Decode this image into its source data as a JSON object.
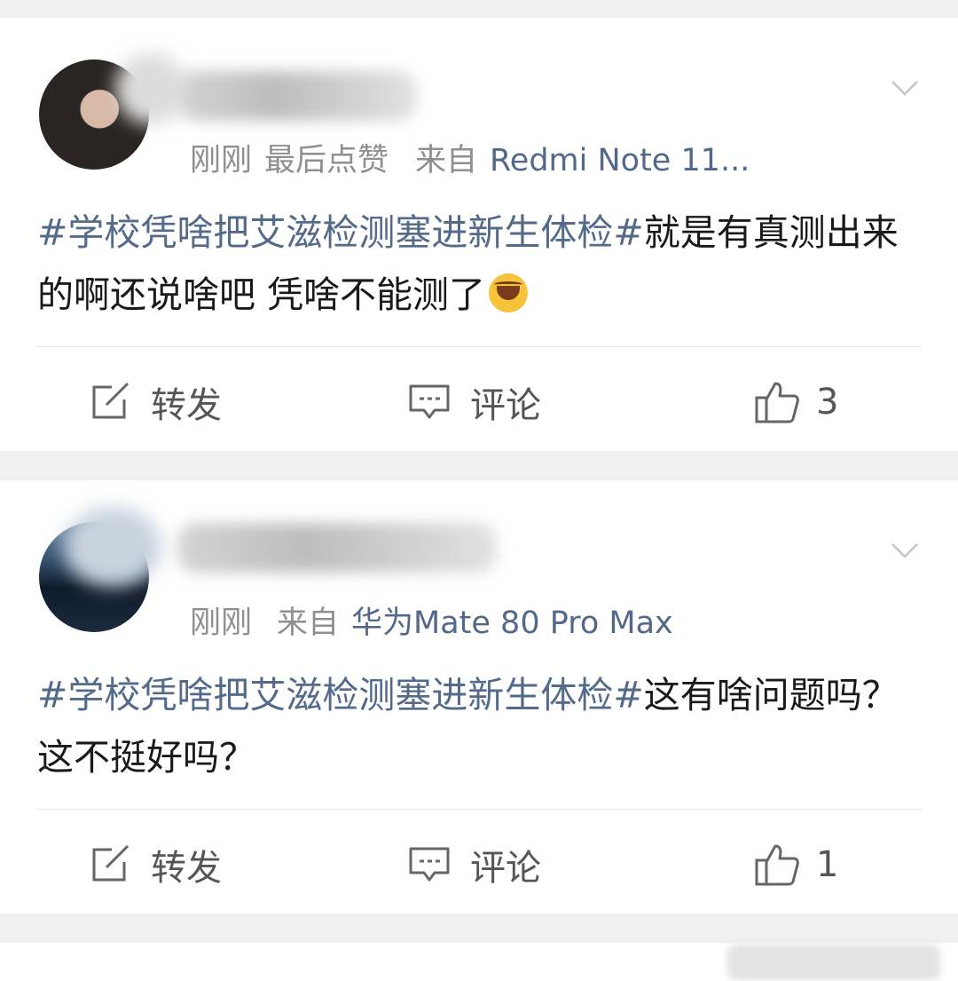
{
  "posts": [
    {
      "meta_time": "刚刚",
      "meta_extra": "最后点赞",
      "meta_from": "来自",
      "source": "Redmi Note 11...",
      "hashtag": "#学校凭啥把艾滋检测塞进新生体检#",
      "text": "就是有真测出来的啊还说啥吧 凭啥不能测了",
      "emoji": "laughing-tears-emoji",
      "actions": {
        "repost": "转发",
        "comment": "评论",
        "like_count": "3"
      }
    },
    {
      "meta_time": "刚刚",
      "meta_from": "来自",
      "source": "华为Mate 80 Pro Max",
      "hashtag": "#学校凭啥把艾滋检测塞进新生体检#",
      "text": "这有啥问题吗？这不挺好吗？",
      "actions": {
        "repost": "转发",
        "comment": "评论",
        "like_count": "1"
      }
    }
  ],
  "colors": {
    "link": "#536a8b",
    "meta": "#8f8f8f",
    "background": "#f0f0f0"
  }
}
